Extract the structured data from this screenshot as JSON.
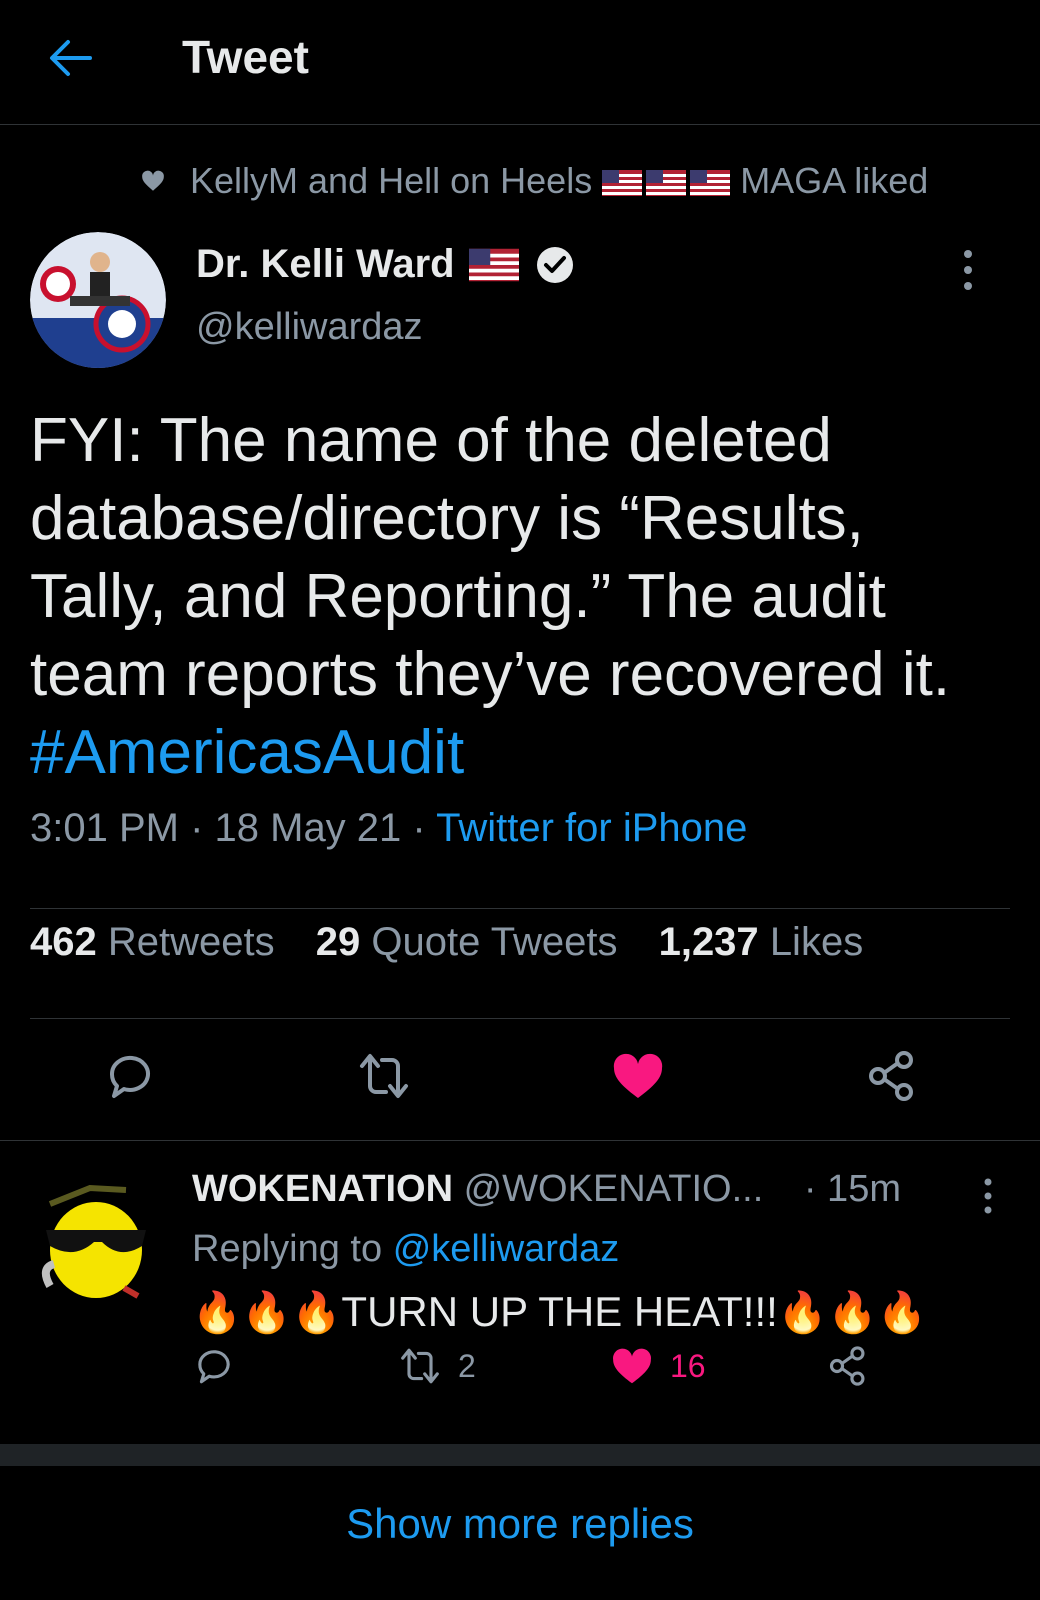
{
  "header": {
    "title": "Tweet"
  },
  "social_context": {
    "text_before": "KellyM and Hell on Heels",
    "text_after": "MAGA liked"
  },
  "tweet": {
    "author_name": "Dr. Kelli Ward",
    "author_handle": "@kelliwardaz",
    "text": "FYI: The name of the deleted database/directory is “Results, Tally, and Reporting.” The audit team reports they’ve recovered it.",
    "hashtag": "#AmericasAudit",
    "time": "3:01 PM · 18 May 21 ·",
    "source": "Twitter for iPhone",
    "stats": {
      "retweets_count": "462",
      "retweets_label": "Retweets",
      "quotes_count": "29",
      "quotes_label": "Quote Tweets",
      "likes_count": "1,237",
      "likes_label": "Likes"
    },
    "actions": [
      "reply-icon",
      "retweet-icon",
      "like-icon",
      "share-icon"
    ],
    "liked": true
  },
  "reply": {
    "author_name": "WOKENATION",
    "author_handle": "@WOKENATIO...",
    "time": "· 15m",
    "replying_prefix": "Replying to",
    "replying_to": "@kelliwardaz",
    "emoji_left": "🔥🔥🔥",
    "text": "TURN UP THE HEAT!!!",
    "emoji_right": "🔥🔥🔥",
    "retweet_count": "2",
    "like_count": "16",
    "liked": true
  },
  "show_more": "Show more replies",
  "colors": {
    "background": "#000000",
    "accent": "#1d9bf0",
    "like": "#f91880",
    "muted": "#8b98a5"
  }
}
